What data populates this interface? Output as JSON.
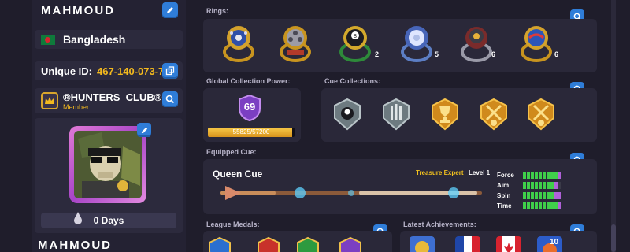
{
  "profile": {
    "name": "MAHMOUD",
    "country": "Bangladesh",
    "uid_label": "Unique ID:",
    "uid_value": "467-140-073-7",
    "club_name": "®HUNTERS_CLUB®",
    "club_role": "Member",
    "days": "0 Days",
    "footer_name": "MAHMOUD"
  },
  "sections": {
    "rings": "Rings:",
    "global_power": "Global Collection Power:",
    "cue_collections": "Cue Collections:",
    "equipped_cue": "Equipped Cue:",
    "league_medals": "League Medals:",
    "latest_achievements": "Latest Achievements:"
  },
  "rings": [
    {
      "name": "blue-gold-ring",
      "count": ""
    },
    {
      "name": "film-reel-ring",
      "count": ""
    },
    {
      "name": "eight-ball-ring",
      "count": "2"
    },
    {
      "name": "cue-ball-ring",
      "count": "5"
    },
    {
      "name": "globe-ring",
      "count": "6"
    },
    {
      "name": "planet-ring",
      "count": "6"
    }
  ],
  "global_power": {
    "level": "69",
    "progress_text": "55825/57200",
    "progress": 0.976
  },
  "cue_collections": [
    {
      "name": "eight-ball-collection",
      "tier": "silver"
    },
    {
      "name": "bars-collection",
      "tier": "silver"
    },
    {
      "name": "trophy-collection",
      "tier": "gold"
    },
    {
      "name": "crossed-swords-collection-2",
      "tier": "gold"
    },
    {
      "name": "crossed-swords-collection-3",
      "tier": "gold"
    }
  ],
  "equipped_cue": {
    "name": "Queen Cue",
    "tag": "Treasure Expert",
    "level": "Level 1",
    "stats": [
      {
        "label": "Force",
        "filled": 9,
        "bonus": 1
      },
      {
        "label": "Aim",
        "filled": 8,
        "bonus": 1
      },
      {
        "label": "Spin",
        "filled": 8,
        "bonus": 2
      },
      {
        "label": "Time",
        "filled": 9,
        "bonus": 1
      }
    ]
  },
  "league_medals": [
    "blue-medal",
    "red-medal",
    "green-medal",
    "purple-medal"
  ],
  "achievements": [
    {
      "name": "gold-laurel-achievement",
      "count": ""
    },
    {
      "name": "france-flag-achievement",
      "count": ""
    },
    {
      "name": "canada-flag-achievement",
      "count": ""
    },
    {
      "name": "ten-achievement",
      "count": "10"
    }
  ],
  "colors": {
    "background": "#1f1d2b",
    "panel": "#2a2839",
    "accent_blue": "#2f7dd8",
    "gold": "#f3b91e",
    "stat_green": "#3fcf4a",
    "stat_purple": "#b061d9"
  }
}
